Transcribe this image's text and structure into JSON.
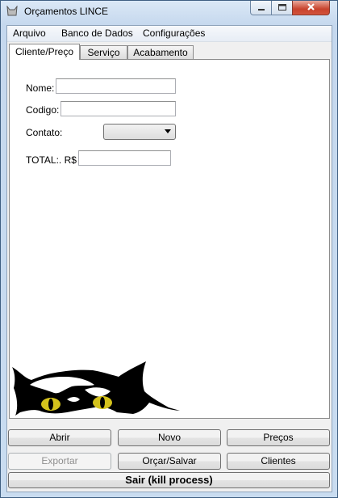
{
  "window": {
    "title": "Orçamentos LINCE"
  },
  "menu": [
    "Arquivo",
    "Banco de Dados",
    "Configurações"
  ],
  "tabs": [
    "Cliente/Preço",
    "Serviço",
    "Acabamento"
  ],
  "form": {
    "nome_label": "Nome:",
    "nome_value": "",
    "codigo_label": "Codigo:",
    "codigo_value": "",
    "contato_label": "Contato:",
    "contato_value": "",
    "total_label": "TOTAL:. R$",
    "total_value": ""
  },
  "buttons": {
    "abrir": "Abrir",
    "novo": "Novo",
    "precos": "Preços",
    "exportar": "Exportar",
    "orcar_salvar": "Orçar/Salvar",
    "clientes": "Clientes",
    "sair": "Sair (kill process)"
  },
  "colors": {
    "eye": "#d4c21c",
    "close_button": "#c8432d"
  },
  "icons": {
    "app": "cat-icon",
    "minimize": "minimize-icon",
    "maximize": "maximize-icon",
    "close": "close-icon"
  }
}
